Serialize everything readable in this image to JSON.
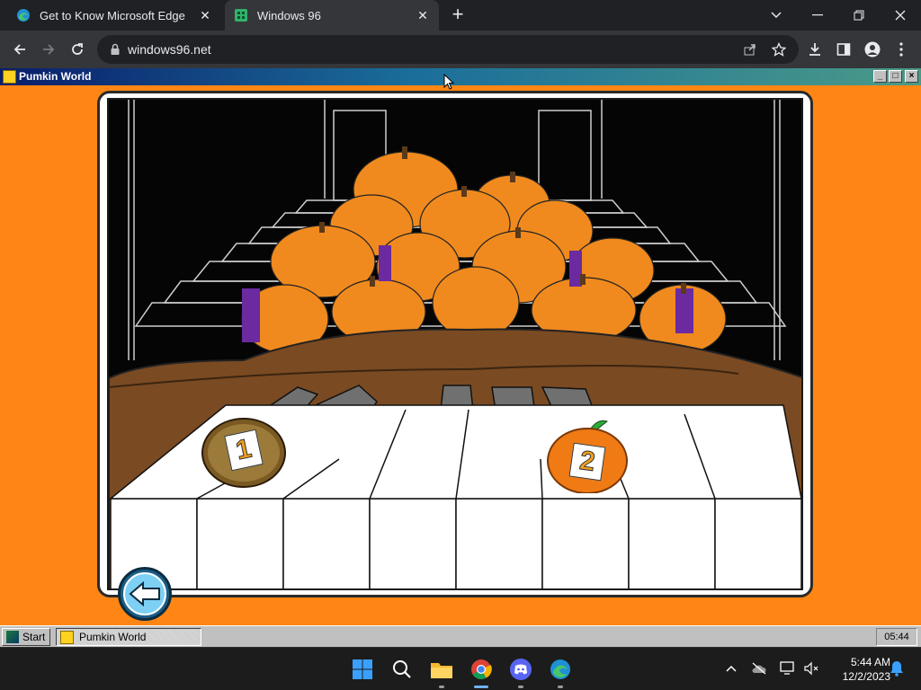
{
  "browser": {
    "tabs": [
      {
        "title": "Get to Know Microsoft Edge",
        "icon": "edge-icon",
        "active": false
      },
      {
        "title": "Windows 96",
        "icon": "windows96-icon",
        "active": true
      }
    ],
    "new_tab_label": "+",
    "url": "windows96.net"
  },
  "w96": {
    "window_title": "Pumkin World",
    "title_buttons": [
      "_",
      "□",
      "×"
    ],
    "start_label": "Start",
    "task_label": "Pumkin World",
    "tray_time": "05:44"
  },
  "game": {
    "choice_1": "1",
    "choice_2": "2",
    "colors": {
      "background": "#ff8614",
      "kiwi": "#7a5a22",
      "orange": "#f07a14",
      "piano_wood": "#7a4a22"
    }
  },
  "windows": {
    "time": "5:44 AM",
    "date": "12/2/2023"
  }
}
